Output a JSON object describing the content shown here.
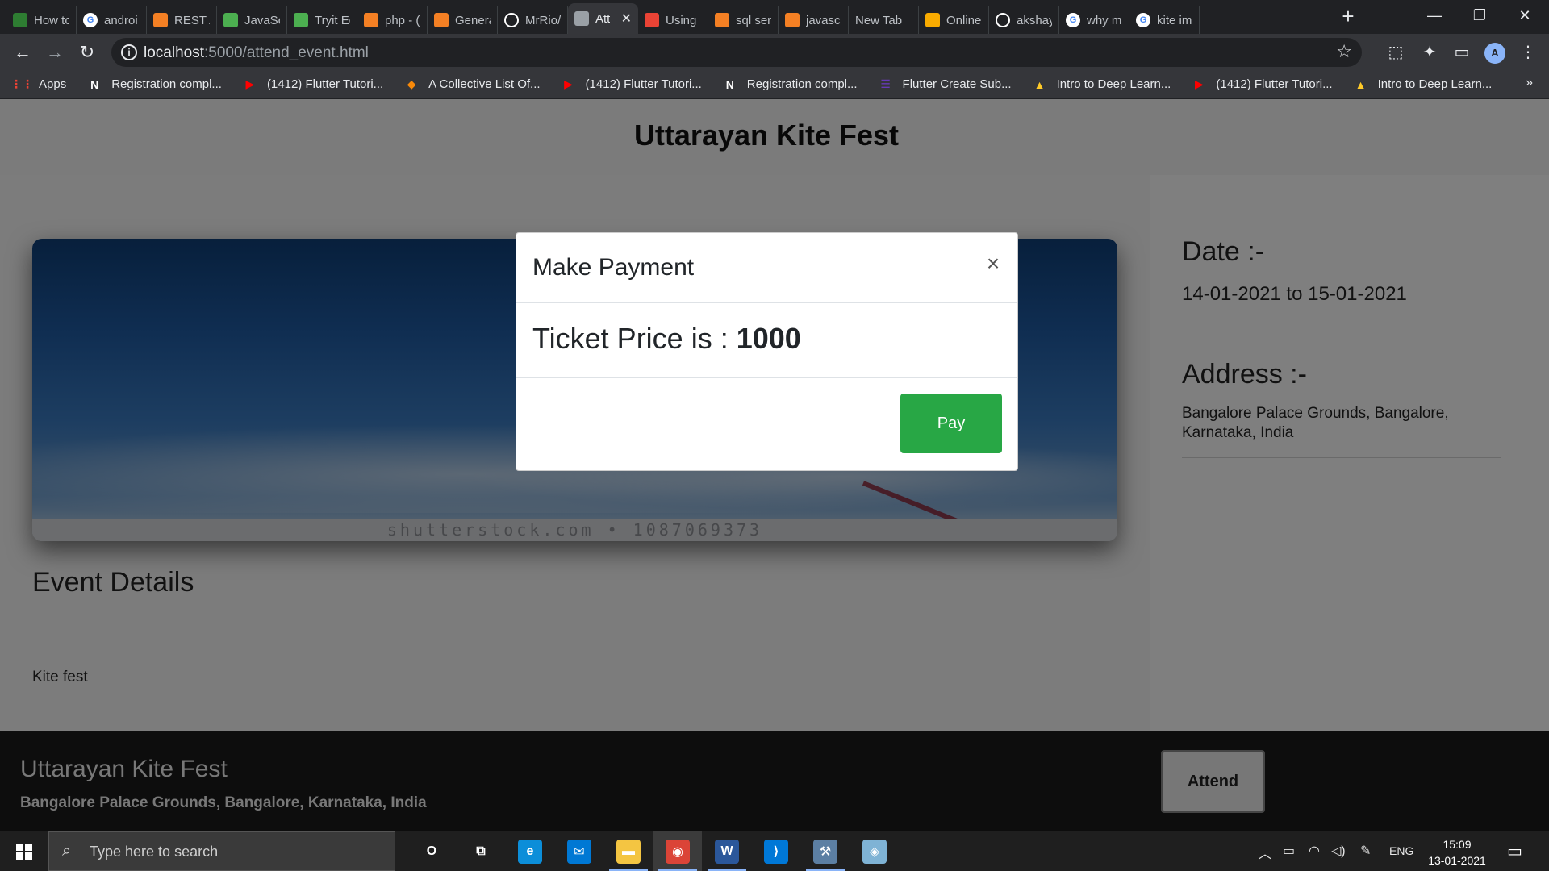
{
  "browser": {
    "tabs": [
      {
        "label": "How to",
        "icon": "chain-icon",
        "color": "#2e7d32",
        "active": false
      },
      {
        "label": "androi",
        "icon": "google-icon",
        "color": "#4285f4",
        "active": false
      },
      {
        "label": "REST A",
        "icon": "stackoverflow-icon",
        "color": "#f48024",
        "active": false
      },
      {
        "label": "JavaSc",
        "icon": "w3schools-icon",
        "color": "#4caf50",
        "active": false
      },
      {
        "label": "Tryit Ec",
        "icon": "w3schools-icon",
        "color": "#4caf50",
        "active": false
      },
      {
        "label": "php - (",
        "icon": "stackoverflow-icon",
        "color": "#f48024",
        "active": false
      },
      {
        "label": "Genera",
        "icon": "stackoverflow-icon",
        "color": "#f48024",
        "active": false
      },
      {
        "label": "MrRio/",
        "icon": "github-icon",
        "color": "#ffffff",
        "active": false
      },
      {
        "label": "Att",
        "icon": "globe-icon",
        "color": "#9aa0a6",
        "active": true
      },
      {
        "label": "Using",
        "icon": "gmail-icon",
        "color": "#ea4335",
        "active": false
      },
      {
        "label": "sql ser",
        "icon": "stackoverflow-icon",
        "color": "#f48024",
        "active": false
      },
      {
        "label": "javascr",
        "icon": "stackoverflow-icon",
        "color": "#f48024",
        "active": false
      },
      {
        "label": "New Tab",
        "icon": "",
        "color": "",
        "active": false
      },
      {
        "label": "Online",
        "icon": "slides-icon",
        "color": "#f9ab00",
        "active": false
      },
      {
        "label": "akshay",
        "icon": "github-icon",
        "color": "#ffffff",
        "active": false
      },
      {
        "label": "why m",
        "icon": "google-icon",
        "color": "#4285f4",
        "active": false
      },
      {
        "label": "kite im",
        "icon": "google-icon",
        "color": "#4285f4",
        "active": false
      }
    ],
    "new_tab_symbol": "+",
    "window_controls": {
      "minimize": "—",
      "restore": "❐",
      "close": "✕"
    },
    "url_host": "localhost",
    "url_path": ":5000/attend_event.html",
    "profile_initial": "A"
  },
  "bookmarks": [
    {
      "label": "Apps",
      "icon": "apps-grid-icon",
      "color": "#ea4335"
    },
    {
      "label": "Registration compl...",
      "icon": "notion-icon",
      "color": "#ffffff"
    },
    {
      "label": "(1412) Flutter Tutori...",
      "icon": "youtube-icon",
      "color": "#ff0000"
    },
    {
      "label": "A Collective List Of...",
      "icon": "kotlin-icon",
      "color": "#f88909"
    },
    {
      "label": "(1412) Flutter Tutori...",
      "icon": "youtube-icon",
      "color": "#ff0000"
    },
    {
      "label": "Registration compl...",
      "icon": "notion-icon",
      "color": "#ffffff"
    },
    {
      "label": "Flutter Create Sub...",
      "icon": "forms-icon",
      "color": "#673ab7"
    },
    {
      "label": "Intro to Deep Learn...",
      "icon": "firebase-icon",
      "color": "#ffca28"
    },
    {
      "label": "(1412) Flutter Tutori...",
      "icon": "youtube-icon",
      "color": "#ff0000"
    },
    {
      "label": "Intro to Deep Learn...",
      "icon": "firebase-icon",
      "color": "#ffca28"
    }
  ],
  "bookmarks_more": "»",
  "page": {
    "header_title": "Uttarayan Kite Fest",
    "hero_watermark": "shutterstock.com • 1087069373",
    "event_details_title": "Event Details",
    "event_description": "Kite fest",
    "date_label": "Date :-",
    "date_value": "14-01-2021 to 15-01-2021",
    "address_label": "Address :-",
    "address_value": "Bangalore Palace Grounds, Bangalore, Karnataka, India",
    "footer_title": "Uttarayan Kite Fest",
    "footer_address": "Bangalore Palace Grounds, Bangalore, Karnataka, India",
    "attend_label": "Attend"
  },
  "modal": {
    "title": "Make Payment",
    "close_symbol": "×",
    "price_prefix": "Ticket Price is : ",
    "price_value": "1000",
    "pay_label": "Pay"
  },
  "taskbar": {
    "search_placeholder": "Type here to search",
    "apps": [
      {
        "name": "cortana-icon",
        "glyph": "O",
        "color": "transparent",
        "running": false,
        "active": false
      },
      {
        "name": "task-view-icon",
        "glyph": "⧉",
        "color": "transparent",
        "running": false,
        "active": false
      },
      {
        "name": "edge-icon",
        "glyph": "e",
        "color": "#0c8ed9",
        "running": false,
        "active": false
      },
      {
        "name": "mail-icon",
        "glyph": "✉",
        "color": "#0078d4",
        "running": false,
        "active": false
      },
      {
        "name": "file-explorer-icon",
        "glyph": "▬",
        "color": "#f4c542",
        "running": true,
        "active": false
      },
      {
        "name": "chrome-icon",
        "glyph": "◉",
        "color": "#db4437",
        "running": true,
        "active": true
      },
      {
        "name": "word-icon",
        "glyph": "W",
        "color": "#2b579a",
        "running": true,
        "active": false
      },
      {
        "name": "vscode-icon",
        "glyph": "⟩",
        "color": "#0078d7",
        "running": false,
        "active": false
      },
      {
        "name": "ssms-icon",
        "glyph": "⚒",
        "color": "#5c7fa3",
        "running": true,
        "active": false
      },
      {
        "name": "app-icon",
        "glyph": "◈",
        "color": "#7fb3d5",
        "running": false,
        "active": false
      }
    ],
    "tray_language": "ENG",
    "time": "15:09",
    "date": "13-01-2021"
  }
}
